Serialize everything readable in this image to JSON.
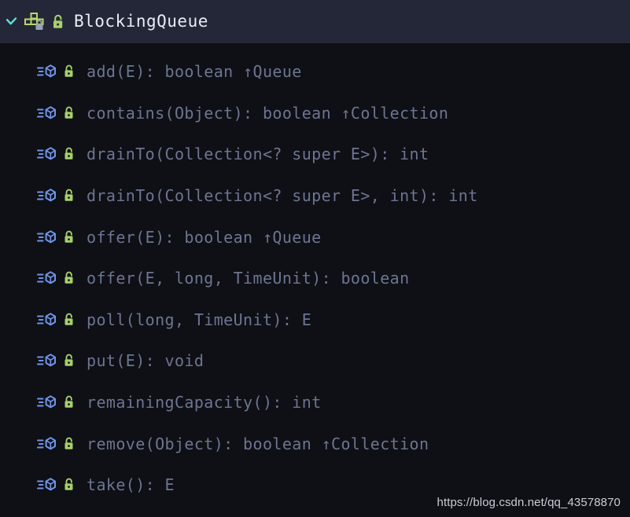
{
  "panel": {
    "name": "structure-panel",
    "background_color": "#0e1016",
    "header_background_color": "#242738"
  },
  "header": {
    "expand_icon": "chevron-down-icon",
    "expand_icon_color": "#5fe0d8",
    "type_icon": "interface-icon",
    "type_icon_color": "#b8d86b",
    "type_icon_badge": "lock-badge-icon",
    "visibility_icon": "lock-open-icon",
    "visibility_icon_color": "#a8cf6a",
    "title": "BlockingQueue",
    "title_color": "#e9ecf5"
  },
  "methods": {
    "icon": "abstract-method-icon",
    "icon_color": "#6f94e8",
    "lock_icon": "lock-open-icon",
    "lock_icon_color": "#a8cf6a",
    "label_color": "#6d7590",
    "items": [
      {
        "signature": "add(E): boolean ↑Queue"
      },
      {
        "signature": "contains(Object): boolean ↑Collection"
      },
      {
        "signature": "drainTo(Collection<? super E>): int"
      },
      {
        "signature": "drainTo(Collection<? super E>, int): int"
      },
      {
        "signature": "offer(E): boolean ↑Queue"
      },
      {
        "signature": "offer(E, long, TimeUnit): boolean"
      },
      {
        "signature": "poll(long, TimeUnit): E"
      },
      {
        "signature": "put(E): void"
      },
      {
        "signature": "remainingCapacity(): int"
      },
      {
        "signature": "remove(Object): boolean ↑Collection"
      },
      {
        "signature": "take(): E"
      }
    ]
  },
  "watermark": {
    "text": "https://blog.csdn.net/qq_43578870"
  }
}
